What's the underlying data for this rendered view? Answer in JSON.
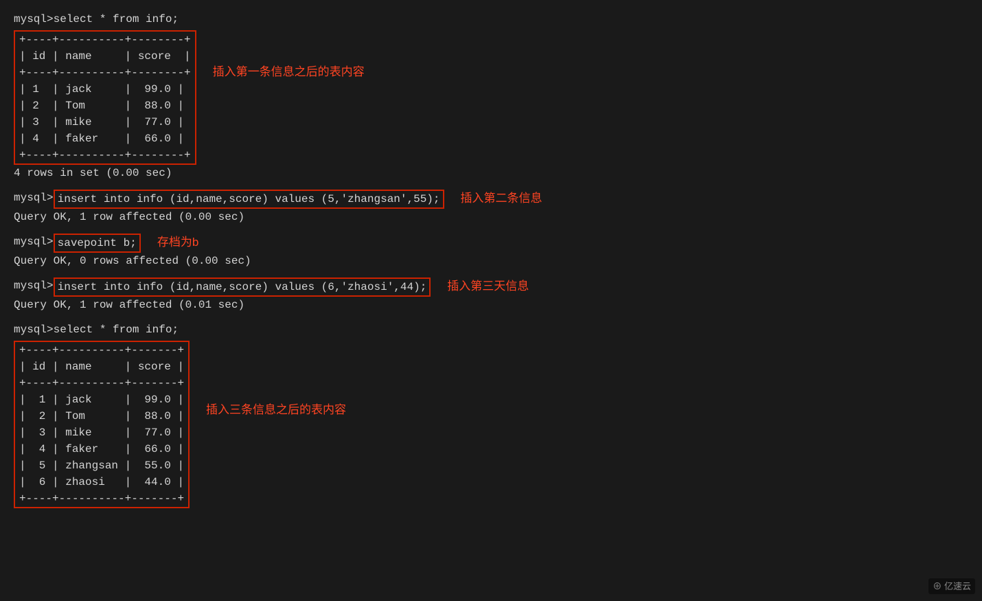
{
  "terminal": {
    "prompt": "mysql> ",
    "query1": "select * from info;",
    "table1": {
      "border": "+----+----------+--------+",
      "header": "| id | name     | score  |",
      "rows": [
        "| 1  | jack     |  99.0  |",
        "| 2  | Tom      |  88.0  |",
        "| 3  | mike     |  77.0  |",
        "| 4  | faker    |  66.0  |"
      ],
      "footer": "4 rows in set (0.00 sec)",
      "annotation": "插入第一条信息之后的表内容"
    },
    "insert1": {
      "command": "insert into info (id,name,score) values (5,'zhangsan',55);",
      "result": "Query OK, 1 row affected (0.00 sec)",
      "annotation": "插入第二条信息"
    },
    "savepoint": {
      "command": "savepoint b;",
      "result": "Query OK, 0 rows affected (0.00 sec)",
      "annotation": "存档为b"
    },
    "insert2": {
      "command": "insert into info (id,name,score) values (6,'zhaosi',44);",
      "result": "Query OK, 1 row affected (0.01 sec)",
      "annotation": "插入第三天信息"
    },
    "query2": "select * from info;",
    "table2": {
      "border": "+----+----------+--------+",
      "header": "| id | name     | score  |",
      "rows": [
        "| 1  | jack     |  99.0  |",
        "| 2  | Tom      |  88.0  |",
        "| 3  | mike     |  77.0  |",
        "| 4  | faker    |  66.0  |",
        "| 5  | zhangsan |  55.0  |",
        "| 6  | zhaosi   |  44.0  |"
      ],
      "annotation": "插入三条信息之后的表内容"
    }
  },
  "watermark": "⊕ 亿速云"
}
